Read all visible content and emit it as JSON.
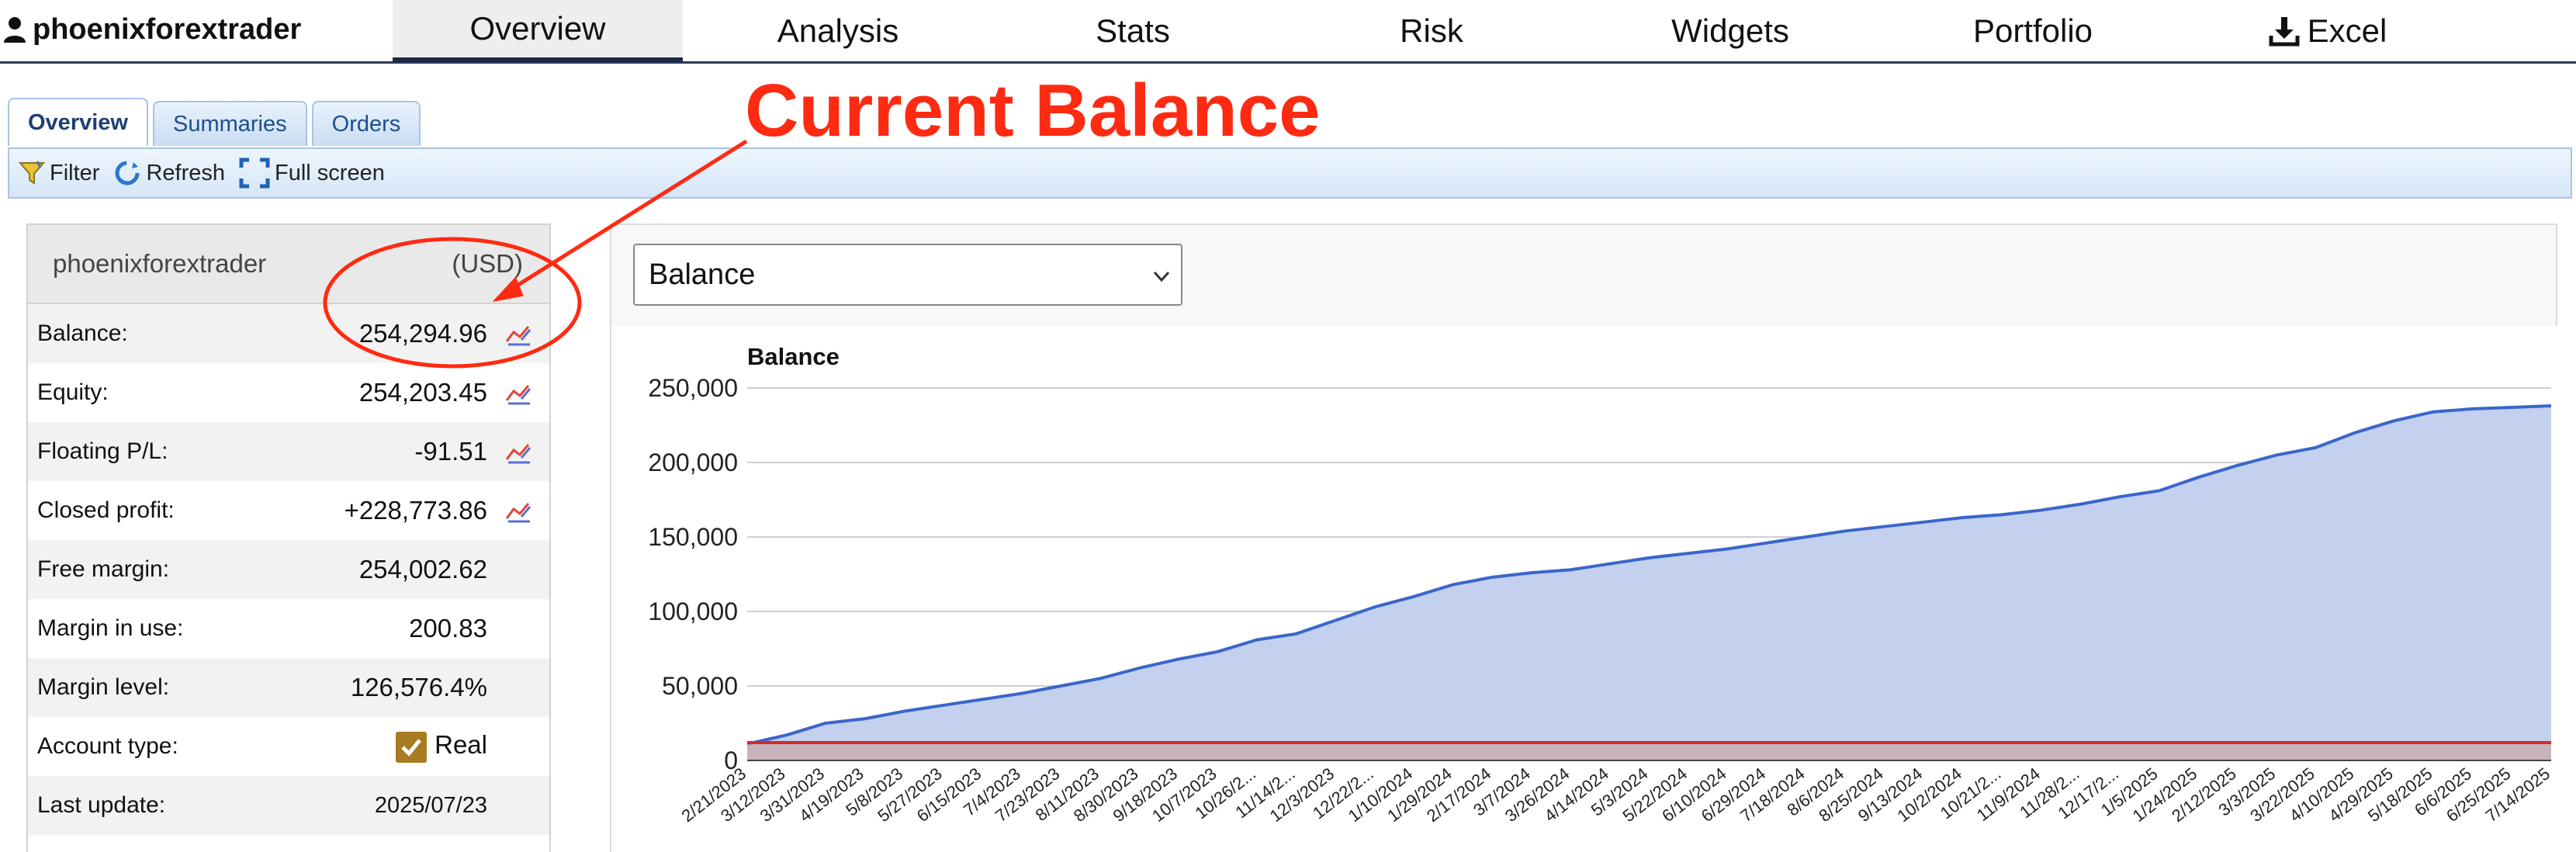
{
  "header": {
    "account_name": "phoenixforextrader",
    "nav": [
      {
        "label": "Overview",
        "active": true
      },
      {
        "label": "Analysis"
      },
      {
        "label": "Stats"
      },
      {
        "label": "Risk"
      },
      {
        "label": "Widgets"
      },
      {
        "label": "Portfolio"
      },
      {
        "label": "Excel"
      }
    ]
  },
  "subtabs": [
    {
      "label": "Overview",
      "active": true
    },
    {
      "label": "Summaries"
    },
    {
      "label": "Orders"
    }
  ],
  "toolbar": {
    "filter": "Filter",
    "refresh": "Refresh",
    "fullscreen": "Full screen"
  },
  "account": {
    "name": "phoenixforextrader",
    "currency": "(USD)",
    "rows": [
      {
        "label": "Balance:",
        "value": "254,294.96"
      },
      {
        "label": "Equity:",
        "value": "254,203.45"
      },
      {
        "label": "Floating P/L:",
        "value": "-91.51"
      },
      {
        "label": "Closed profit:",
        "value": "+228,773.86"
      },
      {
        "label": "Free margin:",
        "value": "254,002.62"
      },
      {
        "label": "Margin in use:",
        "value": "200.83"
      },
      {
        "label": "Margin level:",
        "value": "126,576.4%"
      },
      {
        "label": "Account type:",
        "value": "Real"
      },
      {
        "label": "Last update:",
        "value": "2025/07/23"
      }
    ]
  },
  "chart_select": {
    "value": "Balance"
  },
  "annotation": {
    "text": "Current Balance",
    "color": "#ff2a12"
  },
  "chart_data": {
    "type": "area",
    "title": "Balance",
    "xlabel": "",
    "ylabel": "",
    "ylim": [
      0,
      250000
    ],
    "yticks": [
      "0",
      "50,000",
      "100,000",
      "150,000",
      "200,000",
      "250,000"
    ],
    "categories": [
      "2/21/2023",
      "3/12/2023",
      "3/31/2023",
      "4/19/2023",
      "5/8/2023",
      "5/27/2023",
      "6/15/2023",
      "7/4/2023",
      "7/23/2023",
      "8/11/2023",
      "8/30/2023",
      "9/18/2023",
      "10/7/2023",
      "10/26/2...",
      "11/14/2...",
      "12/3/2023",
      "12/22/2...",
      "1/10/2024",
      "1/29/2024",
      "2/17/2024",
      "3/7/2024",
      "3/26/2024",
      "4/14/2024",
      "5/3/2024",
      "5/22/2024",
      "6/10/2024",
      "6/29/2024",
      "7/18/2024",
      "8/6/2024",
      "8/25/2024",
      "9/13/2024",
      "10/2/2024",
      "10/21/2...",
      "11/9/2024",
      "11/28/2...",
      "12/17/2...",
      "1/5/2025",
      "1/24/2025",
      "2/12/2025",
      "3/3/2025",
      "3/22/2025",
      "4/10/2025",
      "4/29/2025",
      "5/18/2025",
      "6/6/2025",
      "6/25/2025",
      "7/14/2025"
    ],
    "series": [
      {
        "name": "Balance",
        "color": "#3a66c9",
        "fill": "#c3d0ee",
        "values": [
          11000,
          17000,
          25000,
          28000,
          33000,
          37000,
          41000,
          45000,
          50000,
          55000,
          62000,
          68000,
          73000,
          81000,
          85000,
          94000,
          103000,
          110000,
          118000,
          123000,
          126000,
          128000,
          132000,
          136000,
          139000,
          142000,
          146000,
          150000,
          154000,
          157000,
          160000,
          163000,
          165000,
          168000,
          172000,
          177000,
          181000,
          190000,
          198000,
          205000,
          210000,
          220000,
          228000,
          234000,
          236000,
          237000,
          238000
        ]
      },
      {
        "color": "#d52a2a",
        "values": [
          12000,
          12000,
          12000,
          12000,
          12000,
          12000,
          12000,
          12000,
          12000,
          12000,
          12000,
          12000,
          12000,
          12000,
          12000,
          12000,
          12000,
          12000,
          12000,
          12000,
          12000,
          12000,
          12000,
          12000,
          12000,
          12000,
          12000,
          12000,
          12000,
          12000,
          12000,
          12000,
          12000,
          12000,
          12000,
          12000,
          12000,
          12000,
          12000,
          12000,
          12000,
          12000,
          12000,
          12000,
          12000,
          12000,
          12000
        ]
      }
    ],
    "grid": true,
    "legend": "none"
  }
}
